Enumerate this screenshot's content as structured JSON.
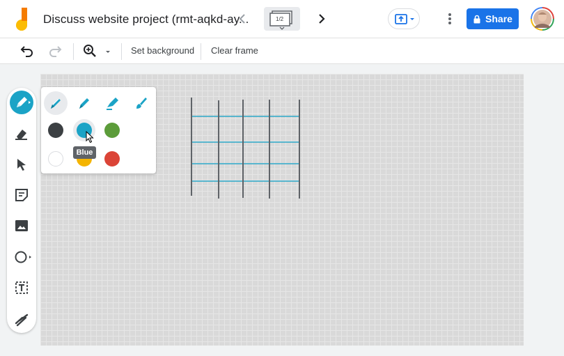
{
  "header": {
    "title": "Discuss website project (rmt-aqkd-ay...",
    "frame_indicator": "1/2",
    "share_label": "Share"
  },
  "toolbar": {
    "set_background_label": "Set background",
    "clear_frame_label": "Clear frame"
  },
  "palette": {
    "tooltip": "Blue",
    "colors": {
      "black": "#3c4043",
      "blue": "#1ba3c6",
      "green": "#5c9c3a",
      "white": "#ffffff",
      "yellow": "#f4b400",
      "red": "#db4437"
    }
  },
  "accent": "#1ba3c6",
  "brand": "#1a73e8"
}
